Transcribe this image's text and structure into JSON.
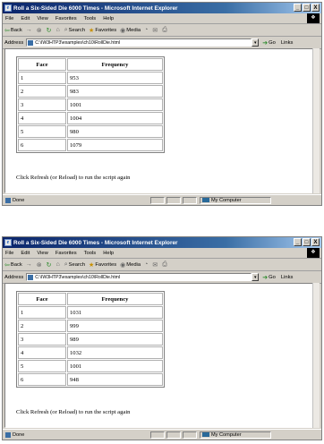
{
  "windows": [
    {
      "title": "Roll a Six-Sided Die 6000 Times - Microsoft Internet Explorer",
      "title_buttons": [
        "_",
        "□",
        "X"
      ],
      "menu": [
        "File",
        "Edit",
        "View",
        "Favorites",
        "Tools",
        "Help"
      ],
      "toolbar": {
        "back": "Back",
        "forward": "→",
        "search": "Search",
        "favorites": "Favorites",
        "media": "Media"
      },
      "address_label": "Address",
      "address_value": "C:\\IW3HTP3\\examples\\ch10\\RollDie.html",
      "go_label": "Go",
      "links_label": "Links",
      "table": {
        "headers": [
          "Face",
          "Frequency"
        ],
        "rows": [
          [
            "1",
            "953"
          ],
          [
            "2",
            "983"
          ],
          [
            "3",
            "1001"
          ],
          [
            "4",
            "1004"
          ],
          [
            "5",
            "980"
          ],
          [
            "6",
            "1079"
          ]
        ]
      },
      "note": "Click Refresh (or Reload) to run the script again",
      "status": "Done",
      "zone": "My Computer"
    },
    {
      "title": "Roll a Six-Sided Die 6000 Times - Microsoft Internet Explorer",
      "title_buttons": [
        "_",
        "□",
        "X"
      ],
      "menu": [
        "File",
        "Edit",
        "View",
        "Favorites",
        "Tools",
        "Help"
      ],
      "toolbar": {
        "back": "Back",
        "forward": "→",
        "search": "Search",
        "favorites": "Favorites",
        "media": "Media"
      },
      "address_label": "Address",
      "address_value": "C:\\IW3HTP3\\examples\\ch10\\RollDie.html",
      "go_label": "Go",
      "links_label": "Links",
      "table": {
        "headers": [
          "Face",
          "Frequency"
        ],
        "rows": [
          [
            "1",
            "1031"
          ],
          [
            "2",
            "999"
          ],
          [
            "3",
            "989"
          ],
          [
            "4",
            "1032"
          ],
          [
            "5",
            "1001"
          ],
          [
            "6",
            "948"
          ]
        ]
      },
      "note": "Click Refresh (or Reload) to run the script again",
      "status": "Done",
      "zone": "My Computer"
    }
  ],
  "icons": [
    "ie-page-icon",
    "back-arrow-icon",
    "stop-icon",
    "refresh-icon",
    "home-icon",
    "search-icon",
    "favorites-icon",
    "media-icon",
    "history-icon",
    "mail-icon",
    "print-icon",
    "go-arrow-icon",
    "scrollbar-track",
    "computer-icon"
  ],
  "colors": {
    "titlebar": "#0a246a",
    "chrome": "#d4d0c8"
  }
}
